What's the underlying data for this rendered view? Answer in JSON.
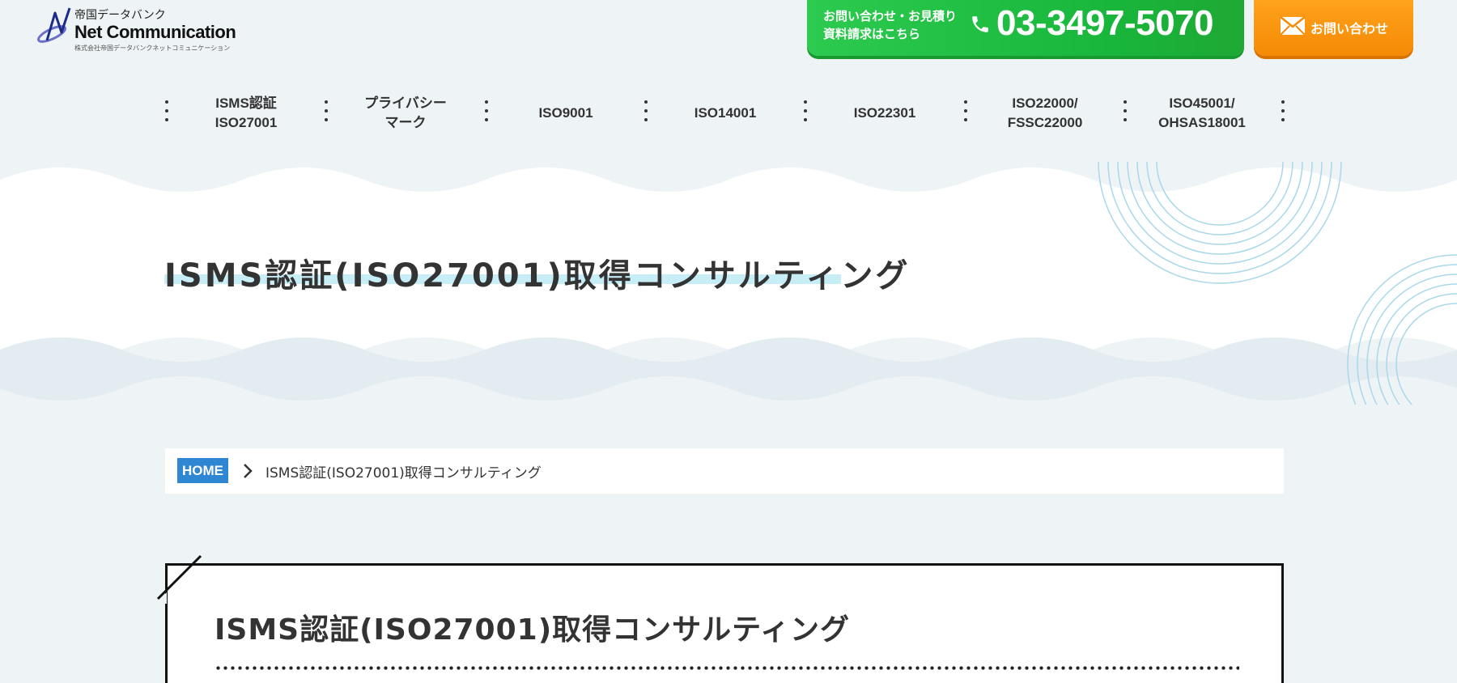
{
  "header": {
    "logo": {
      "top_text": "帝国データバンク",
      "main_text": "Net Communication",
      "sub_text": "株式会社帝国データバンクネットコミュニケーション"
    },
    "phone_cta": {
      "line1": "お問い合わせ・お見積り",
      "line2": "資料請求はこちら",
      "number": "03-3497-5070",
      "icon": "phone-icon",
      "color": "#1fba3e"
    },
    "mail_cta": {
      "label": "お問い合わせ",
      "icon": "mail-icon",
      "color": "#f7900a"
    }
  },
  "nav": {
    "items": [
      {
        "label": "ISMS認証\nISO27001"
      },
      {
        "label": "プライバシー\nマーク"
      },
      {
        "label": "ISO9001"
      },
      {
        "label": "ISO14001"
      },
      {
        "label": "ISO22301"
      },
      {
        "label": "ISO22000/\nFSSC22000"
      },
      {
        "label": "ISO45001/\nOHSAS18001"
      }
    ]
  },
  "hero": {
    "title": "ISMS認証(ISO27001)取得コンサルティング",
    "highlight_color": "#c7edf6"
  },
  "breadcrumb": {
    "home": "HOME",
    "current": "ISMS認証(ISO27001)取得コンサルティング",
    "home_color": "#2f86d3"
  },
  "content": {
    "card_title": "ISMS認証(ISO27001)取得コンサルティング"
  }
}
